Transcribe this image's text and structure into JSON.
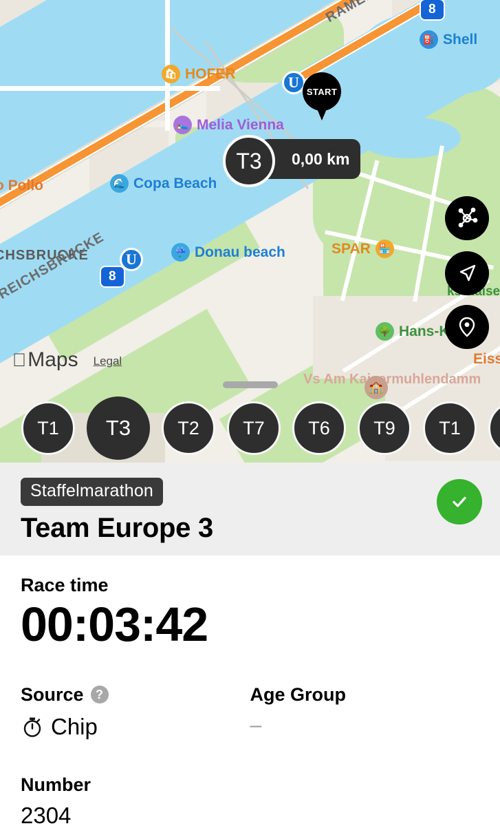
{
  "map": {
    "start_pin_label": "START",
    "active_marker": {
      "label": "T3",
      "distance": "0,00 km"
    },
    "attribution": {
      "brand": "Maps",
      "apple_glyph": "",
      "legal_link": "Legal"
    },
    "pois": [
      {
        "name": "HOFER",
        "icon": "shop-icon"
      },
      {
        "name": "Melia Vienna",
        "icon": "hotel-icon"
      },
      {
        "name": "Copa Beach",
        "icon": "beach-icon"
      },
      {
        "name": "Donau beach",
        "icon": "beach-icon"
      },
      {
        "name": "SPAR",
        "icon": "store-icon"
      },
      {
        "name": "Shell",
        "icon": "fuel-icon"
      },
      {
        "name": "to Pollo",
        "icon": "none"
      },
      {
        "name": "ser",
        "icon": "none"
      },
      {
        "name": "Vs Am Kaisermuhlendamm",
        "icon": "school-icon"
      },
      {
        "name": "ks Kaise",
        "icon": "none"
      },
      {
        "name": "Hans-K",
        "icon": "none"
      },
      {
        "name": "Eiss",
        "icon": "none"
      }
    ],
    "streets": [
      "RAMER STRASSE",
      "CHSBRUCKE",
      "REICHSBRUCKE"
    ],
    "route_shields": [
      "8",
      "8"
    ],
    "transit_badges": [
      "U",
      "U"
    ],
    "controls": [
      {
        "name": "route-network-button",
        "icon": "network-nodes-icon"
      },
      {
        "name": "navigate-button",
        "icon": "navigation-arrow-icon"
      },
      {
        "name": "locate-button",
        "icon": "map-pin-icon"
      }
    ],
    "team_chips": [
      {
        "label": "T1",
        "selected": false
      },
      {
        "label": "T3",
        "selected": true
      },
      {
        "label": "T2",
        "selected": false
      },
      {
        "label": "T7",
        "selected": false
      },
      {
        "label": "T6",
        "selected": false
      },
      {
        "label": "T9",
        "selected": false
      },
      {
        "label": "T1",
        "selected": false
      }
    ]
  },
  "detail": {
    "race_tag": "Staffelmarathon",
    "team_name": "Team Europe 3",
    "status_icon": "check-icon",
    "status_color": "#36b22e",
    "race_time_label": "Race time",
    "race_time_value": "00:03:42",
    "source_label": "Source",
    "source_help_icon": "?",
    "source_value": "Chip",
    "source_icon": "stopwatch-icon",
    "age_group_label": "Age Group",
    "age_group_value": "–",
    "number_label": "Number",
    "number_value": "2304"
  }
}
